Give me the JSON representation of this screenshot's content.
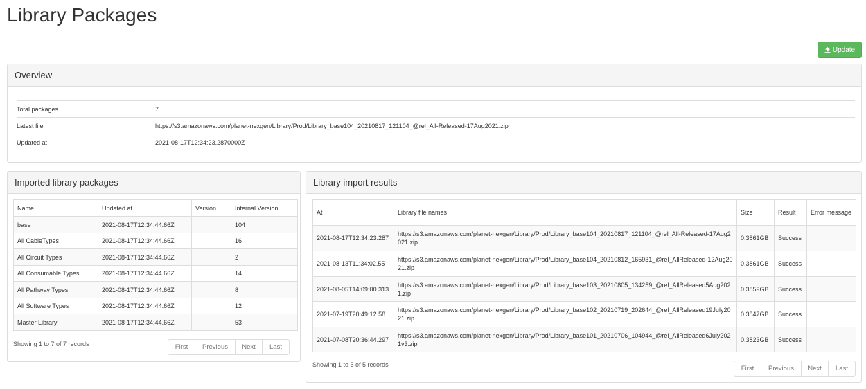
{
  "page": {
    "title": "Library Packages",
    "update_label": "Update"
  },
  "overview": {
    "heading": "Overview",
    "rows": [
      {
        "label": "Total packages",
        "value": "7"
      },
      {
        "label": "Latest file",
        "value": "https://s3.amazonaws.com/planet-nexgen/Library/Prod/Library_base104_20210817_121104_@rel_All-Released-17Aug2021.zip"
      },
      {
        "label": "Updated at",
        "value": "2021-08-17T12:34:23.2870000Z"
      }
    ]
  },
  "imported": {
    "heading": "Imported library packages",
    "columns": [
      "Name",
      "Updated at",
      "Version",
      "Internal Version"
    ],
    "rows": [
      [
        "base",
        "2021-08-17T12:34:44.66Z",
        "",
        "104"
      ],
      [
        "All CableTypes",
        "2021-08-17T12:34:44.66Z",
        "",
        "16"
      ],
      [
        "All Circuit Types",
        "2021-08-17T12:34:44.66Z",
        "",
        "2"
      ],
      [
        "All Consumable Types",
        "2021-08-17T12:34:44.66Z",
        "",
        "14"
      ],
      [
        "All Pathway Types",
        "2021-08-17T12:34:44.66Z",
        "",
        "8"
      ],
      [
        "All Software Types",
        "2021-08-17T12:34:44.66Z",
        "",
        "12"
      ],
      [
        "Master Library",
        "2021-08-17T12:34:44.66Z",
        "",
        "53"
      ]
    ],
    "showing": "Showing 1 to 7 of 7 records",
    "pager": [
      "First",
      "Previous",
      "Next",
      "Last"
    ]
  },
  "results": {
    "heading": "Library import results",
    "columns": [
      "At",
      "Library file names",
      "Size",
      "Result",
      "Error message"
    ],
    "rows": [
      [
        "2021-08-17T12:34:23.287",
        "https://s3.amazonaws.com/planet-nexgen/Library/Prod/Library_base104_20210817_121104_@rel_All-Released-17Aug2021.zip",
        "0.3861GB",
        "Success",
        ""
      ],
      [
        "2021-08-13T11:34:02.55",
        "https://s3.amazonaws.com/planet-nexgen/Library/Prod/Library_base104_20210812_165931_@rel_AllReleased-12Aug2021.zip",
        "0.3861GB",
        "Success",
        ""
      ],
      [
        "2021-08-05T14:09:00.313",
        "https://s3.amazonaws.com/planet-nexgen/Library/Prod/Library_base103_20210805_134259_@rel_AllReleased5Aug2021.zip",
        "0.3859GB",
        "Success",
        ""
      ],
      [
        "2021-07-19T20:49:12.58",
        "https://s3.amazonaws.com/planet-nexgen/Library/Prod/Library_base102_20210719_202644_@rel_AllReleased19July2021.zip",
        "0.3847GB",
        "Success",
        ""
      ],
      [
        "2021-07-08T20:36:44.297",
        "https://s3.amazonaws.com/planet-nexgen/Library/Prod/Library_base101_20210706_104944_@rel_AllReleased6July2021v3.zip",
        "0.3823GB",
        "Success",
        ""
      ]
    ],
    "showing": "Showing 1 to 5 of 5 records",
    "pager": [
      "First",
      "Previous",
      "Next",
      "Last"
    ]
  },
  "colors": {
    "update_button": "#5cb85c",
    "panel_heading": "#f5f5f5",
    "border": "#dddddd"
  },
  "icons": {
    "update": "upload-icon"
  }
}
